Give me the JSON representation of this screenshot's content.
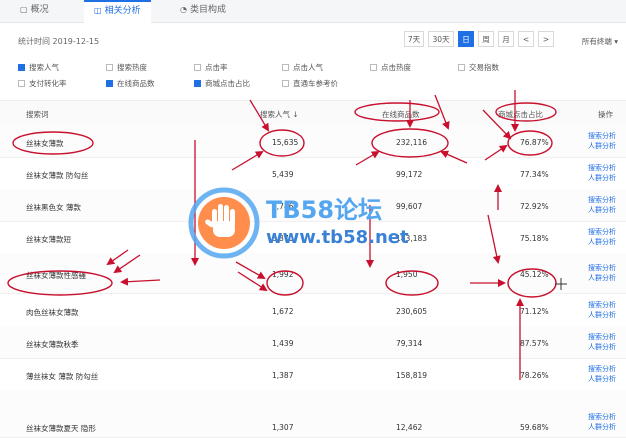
{
  "tabs": [
    {
      "label": "概况",
      "icon": "overview-icon"
    },
    {
      "label": "相关分析",
      "icon": "analysis-icon"
    },
    {
      "label": "类目构成",
      "icon": "category-icon"
    }
  ],
  "toolbar": {
    "stat_time": "统计时间 2019-12-15",
    "ranges": [
      "7天",
      "30天",
      "日",
      "周",
      "月"
    ],
    "active_range": "日",
    "prev": "<",
    "next": ">",
    "terminal_select": "所有终端"
  },
  "metrics": [
    {
      "label": "搜索人气",
      "checked": true
    },
    {
      "label": "搜索热度",
      "checked": false
    },
    {
      "label": "点击率",
      "checked": false
    },
    {
      "label": "点击人气",
      "checked": false
    },
    {
      "label": "点击热度",
      "checked": false
    },
    {
      "label": "交易指数",
      "checked": false
    },
    {
      "label": "支付转化率",
      "checked": false
    },
    {
      "label": "在线商品数",
      "checked": true
    },
    {
      "label": "商城点击占比",
      "checked": true
    },
    {
      "label": "直通车参考价",
      "checked": false
    }
  ],
  "table": {
    "headers": {
      "keyword": "搜索词",
      "popularity": "搜索人气 ↓",
      "online_count": "在线商品数",
      "mall_ratio": "商城点击占比",
      "ops": "操作"
    },
    "op_labels": [
      "搜索分析",
      "人群分析"
    ],
    "rows": [
      {
        "keyword": "丝袜女薄款",
        "popularity": "15,635",
        "online_count": "232,116",
        "mall_ratio": "76.87%"
      },
      {
        "keyword": "丝袜女薄款 防勾丝",
        "popularity": "5,439",
        "online_count": "99,172",
        "mall_ratio": "77.34%"
      },
      {
        "keyword": "丝袜黑色女 薄款",
        "popularity": "3,746",
        "online_count": "99,607",
        "mall_ratio": "72.92%"
      },
      {
        "keyword": "丝袜女薄款短",
        "popularity": "3,370",
        "online_count": "183,183",
        "mall_ratio": "75.18%"
      },
      {
        "keyword": "丝袜女薄款性感骚",
        "popularity": "1,992",
        "online_count": "1,950",
        "mall_ratio": "45.12%"
      },
      {
        "keyword": "肉色丝袜女薄款",
        "popularity": "1,672",
        "online_count": "230,605",
        "mall_ratio": "71.12%"
      },
      {
        "keyword": "丝袜女薄款秋季",
        "popularity": "1,439",
        "online_count": "79,314",
        "mall_ratio": "87.57%"
      },
      {
        "keyword": "薄丝袜女 薄款 防勾丝",
        "popularity": "1,387",
        "online_count": "158,819",
        "mall_ratio": "78.26%"
      },
      {
        "keyword": "丝袜女薄款夏天 隐形",
        "popularity": "1,307",
        "online_count": "12,462",
        "mall_ratio": "59.68%"
      }
    ]
  },
  "watermark": {
    "title": "TB58论坛",
    "url": "www.tb58.net",
    "colors": {
      "primary": "#55a6f0",
      "accent": "#ff7a2e"
    }
  },
  "colors": {
    "accent": "#1f6fe5",
    "annotation": "#c8102e"
  }
}
